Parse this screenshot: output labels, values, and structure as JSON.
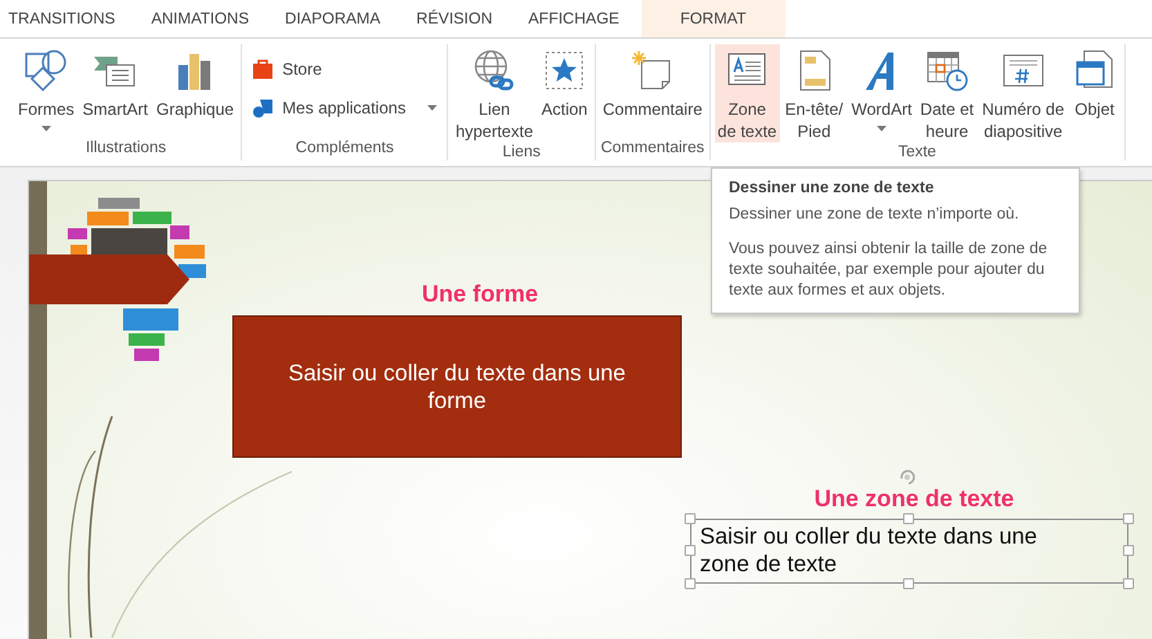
{
  "tabs": [
    {
      "label": "TRANSITIONS",
      "selected": false,
      "contextual": false
    },
    {
      "label": "ANIMATIONS",
      "selected": false,
      "contextual": false
    },
    {
      "label": "DIAPORAMA",
      "selected": false,
      "contextual": false
    },
    {
      "label": "RÉVISION",
      "selected": false,
      "contextual": false
    },
    {
      "label": "AFFICHAGE",
      "selected": false,
      "contextual": false
    },
    {
      "label": "FORMAT",
      "selected": false,
      "contextual": true
    }
  ],
  "groups": [
    {
      "label": "Illustrations",
      "items": [
        {
          "label": "Formes",
          "kind": "large",
          "dropdown": true,
          "hovered": false
        },
        {
          "label": "SmartArt",
          "kind": "large",
          "dropdown": false,
          "hovered": false
        },
        {
          "label": "Graphique",
          "kind": "large",
          "dropdown": false,
          "hovered": false
        }
      ]
    },
    {
      "label": "Compléments",
      "items": [
        {
          "label": "Store",
          "kind": "small",
          "dropdown": false,
          "hovered": false
        },
        {
          "label": "Mes applications",
          "kind": "small",
          "dropdown": true,
          "hovered": false
        }
      ]
    },
    {
      "label": "Liens",
      "items": [
        {
          "label": "Lien\nhypertexte",
          "kind": "large",
          "dropdown": false,
          "hovered": false
        },
        {
          "label": "Action",
          "kind": "large",
          "dropdown": false,
          "hovered": false
        }
      ]
    },
    {
      "label": "Commentaires",
      "items": [
        {
          "label": "Commentaire",
          "kind": "large",
          "dropdown": false,
          "hovered": false
        }
      ]
    },
    {
      "label": "Texte",
      "items": [
        {
          "label": "Zone\nde texte",
          "kind": "large",
          "dropdown": false,
          "hovered": true
        },
        {
          "label": "En-tête/\nPied",
          "kind": "large",
          "dropdown": false,
          "hovered": false
        },
        {
          "label": "WordArt",
          "kind": "large",
          "dropdown": true,
          "hovered": false
        },
        {
          "label": "Date et\nheure",
          "kind": "large",
          "dropdown": false,
          "hovered": false
        },
        {
          "label": "Numéro de\ndiapositive",
          "kind": "large",
          "dropdown": false,
          "hovered": false
        },
        {
          "label": "Objet",
          "kind": "large",
          "dropdown": false,
          "hovered": false
        }
      ]
    }
  ],
  "tooltip": {
    "title": "Dessiner une zone de texte",
    "paragraphs": [
      "Dessiner une zone de texte n’importe où.",
      "Vous pouvez ainsi obtenir la taille de zone de texte souhaitée, par exemple pour ajouter du texte aux formes et aux objets."
    ]
  },
  "slide": {
    "shape_title": "Une forme",
    "shape_text": "Saisir ou coller du texte dans une forme",
    "textbox_title": "Une zone de texte",
    "textbox_text": "Saisir ou coller du texte dans une zone de texte",
    "textbox_selected": true
  }
}
